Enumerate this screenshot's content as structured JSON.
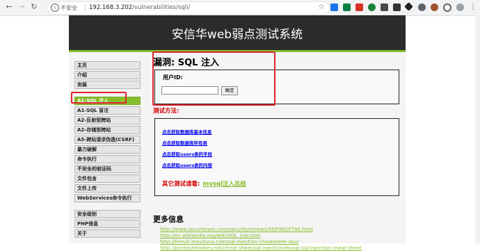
{
  "browser": {
    "insecure_label": "不安全",
    "url_host": "192.168.3.202",
    "url_path": "/vulnerabilities/sqli/"
  },
  "site": {
    "title": "安信华web弱点测试系统",
    "accent_color": "#85bf2b"
  },
  "sidebar": {
    "group1": [
      "主页",
      "介绍",
      "安装"
    ],
    "group2": [
      "A1-SQL 注入",
      "A1-SQL 盲注",
      "A2-反射型跨站",
      "A2-存储型跨站",
      "A5-跨站请求伪造(CSRF)",
      "暴力破解",
      "命令执行",
      "不安全的验证码",
      "文件包含",
      "文件上传",
      "WebServices命令执行"
    ],
    "group3": [
      "安全级别",
      "PHP信息",
      "关于"
    ],
    "selected": "A1-SQL 注入"
  },
  "main": {
    "vuln_title": "漏洞: SQL 注入",
    "form": {
      "label": "用户ID:",
      "input_value": "",
      "submit_label": "确定"
    },
    "test_method_label": "测试方法:",
    "test_links": [
      "点击获取数据库基本信息",
      "点击获取数据库所有表",
      "点击获取users表的字段",
      "点击获取users表的内容"
    ],
    "other_tests_label": "其它测试请看:",
    "other_tests_link": "mysql注入总结",
    "more_info_title": "更多信息",
    "references": [
      "http://www.securiteam.com/securityreviews/5DP0N1P76E.html",
      "http://en.wikipedia.org/wiki/SQL_injection",
      "http://ferruh.mavituna.com/sql-injection-cheatsheet-oku/",
      "http://pentestmonkey.net/cheat-sheet/sql-injection/mysql-sql-injection-cheat-sheet"
    ]
  }
}
